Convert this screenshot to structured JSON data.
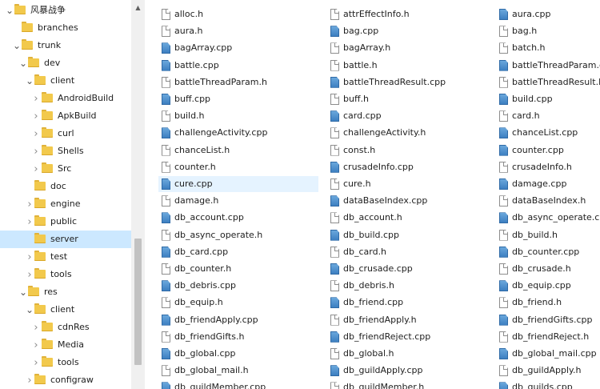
{
  "tree": [
    {
      "label": "风暴战争",
      "level": 0,
      "state": "expanded"
    },
    {
      "label": "branches",
      "level": 1,
      "state": "none"
    },
    {
      "label": "trunk",
      "level": 1,
      "state": "expanded"
    },
    {
      "label": "dev",
      "level": 2,
      "state": "expanded"
    },
    {
      "label": "client",
      "level": 3,
      "state": "expanded"
    },
    {
      "label": "AndroidBuild",
      "level": 4,
      "state": "collapsed"
    },
    {
      "label": "ApkBuild",
      "level": 4,
      "state": "collapsed"
    },
    {
      "label": "curl",
      "level": 4,
      "state": "collapsed"
    },
    {
      "label": "Shells",
      "level": 4,
      "state": "collapsed"
    },
    {
      "label": "Src",
      "level": 4,
      "state": "collapsed"
    },
    {
      "label": "doc",
      "level": 3,
      "state": "none"
    },
    {
      "label": "engine",
      "level": 3,
      "state": "collapsed"
    },
    {
      "label": "public",
      "level": 3,
      "state": "collapsed"
    },
    {
      "label": "server",
      "level": 3,
      "state": "none",
      "selected": true
    },
    {
      "label": "test",
      "level": 3,
      "state": "collapsed"
    },
    {
      "label": "tools",
      "level": 3,
      "state": "collapsed"
    },
    {
      "label": "res",
      "level": 2,
      "state": "expanded"
    },
    {
      "label": "client",
      "level": 3,
      "state": "expanded"
    },
    {
      "label": "cdnRes",
      "level": 4,
      "state": "collapsed"
    },
    {
      "label": "Media",
      "level": 4,
      "state": "collapsed"
    },
    {
      "label": "tools",
      "level": 4,
      "state": "collapsed"
    },
    {
      "label": "configraw",
      "level": 3,
      "state": "collapsed"
    }
  ],
  "files": [
    [
      {
        "name": "alloc.h",
        "type": "h"
      },
      {
        "name": "aura.h",
        "type": "h"
      },
      {
        "name": "bagArray.cpp",
        "type": "cpp"
      },
      {
        "name": "battle.cpp",
        "type": "cpp"
      },
      {
        "name": "battleThreadParam.h",
        "type": "h"
      },
      {
        "name": "buff.cpp",
        "type": "cpp"
      },
      {
        "name": "build.h",
        "type": "h"
      },
      {
        "name": "challengeActivity.cpp",
        "type": "cpp"
      },
      {
        "name": "chanceList.h",
        "type": "h"
      },
      {
        "name": "counter.h",
        "type": "h"
      },
      {
        "name": "cure.cpp",
        "type": "cpp",
        "selected": true
      },
      {
        "name": "damage.h",
        "type": "h"
      },
      {
        "name": "db_account.cpp",
        "type": "cpp"
      },
      {
        "name": "db_async_operate.h",
        "type": "h"
      },
      {
        "name": "db_card.cpp",
        "type": "cpp"
      },
      {
        "name": "db_counter.h",
        "type": "h"
      },
      {
        "name": "db_debris.cpp",
        "type": "cpp"
      },
      {
        "name": "db_equip.h",
        "type": "h"
      },
      {
        "name": "db_friendApply.cpp",
        "type": "cpp"
      },
      {
        "name": "db_friendGifts.h",
        "type": "h"
      },
      {
        "name": "db_global.cpp",
        "type": "cpp"
      },
      {
        "name": "db_global_mail.h",
        "type": "h"
      },
      {
        "name": "db_guildMember.cpp",
        "type": "cpp"
      }
    ],
    [
      {
        "name": "attrEffectInfo.h",
        "type": "h"
      },
      {
        "name": "bag.cpp",
        "type": "cpp"
      },
      {
        "name": "bagArray.h",
        "type": "h"
      },
      {
        "name": "battle.h",
        "type": "h"
      },
      {
        "name": "battleThreadResult.cpp",
        "type": "cpp"
      },
      {
        "name": "buff.h",
        "type": "h"
      },
      {
        "name": "card.cpp",
        "type": "cpp"
      },
      {
        "name": "challengeActivity.h",
        "type": "h"
      },
      {
        "name": "const.h",
        "type": "h"
      },
      {
        "name": "crusadeInfo.cpp",
        "type": "cpp"
      },
      {
        "name": "cure.h",
        "type": "h"
      },
      {
        "name": "dataBaseIndex.cpp",
        "type": "cpp"
      },
      {
        "name": "db_account.h",
        "type": "h"
      },
      {
        "name": "db_build.cpp",
        "type": "cpp"
      },
      {
        "name": "db_card.h",
        "type": "h"
      },
      {
        "name": "db_crusade.cpp",
        "type": "cpp"
      },
      {
        "name": "db_debris.h",
        "type": "h"
      },
      {
        "name": "db_friend.cpp",
        "type": "cpp"
      },
      {
        "name": "db_friendApply.h",
        "type": "h"
      },
      {
        "name": "db_friendReject.cpp",
        "type": "cpp"
      },
      {
        "name": "db_global.h",
        "type": "h"
      },
      {
        "name": "db_guildApply.cpp",
        "type": "cpp"
      },
      {
        "name": "db_guildMember.h",
        "type": "h"
      }
    ],
    [
      {
        "name": "aura.cpp",
        "type": "cpp"
      },
      {
        "name": "bag.h",
        "type": "h"
      },
      {
        "name": "batch.h",
        "type": "h"
      },
      {
        "name": "battleThreadParam.cpp",
        "type": "cpp"
      },
      {
        "name": "battleThreadResult.h",
        "type": "h"
      },
      {
        "name": "build.cpp",
        "type": "cpp"
      },
      {
        "name": "card.h",
        "type": "h"
      },
      {
        "name": "chanceList.cpp",
        "type": "cpp"
      },
      {
        "name": "counter.cpp",
        "type": "cpp"
      },
      {
        "name": "crusadeInfo.h",
        "type": "h"
      },
      {
        "name": "damage.cpp",
        "type": "cpp"
      },
      {
        "name": "dataBaseIndex.h",
        "type": "h"
      },
      {
        "name": "db_async_operate.cpp",
        "type": "cpp"
      },
      {
        "name": "db_build.h",
        "type": "h"
      },
      {
        "name": "db_counter.cpp",
        "type": "cpp"
      },
      {
        "name": "db_crusade.h",
        "type": "h"
      },
      {
        "name": "db_equip.cpp",
        "type": "cpp"
      },
      {
        "name": "db_friend.h",
        "type": "h"
      },
      {
        "name": "db_friendGifts.cpp",
        "type": "cpp"
      },
      {
        "name": "db_friendReject.h",
        "type": "h"
      },
      {
        "name": "db_global_mail.cpp",
        "type": "cpp"
      },
      {
        "name": "db_guildApply.h",
        "type": "h"
      },
      {
        "name": "db_guilds.cpp",
        "type": "cpp"
      }
    ]
  ],
  "icons": {
    "expanded": "chevron-down-icon",
    "collapsed": "chevron-right-icon",
    "folder": "folder-icon",
    "header_file": "header-file-icon",
    "cpp_file": "cpp-file-icon",
    "scroll_up": "scroll-up-arrow-icon"
  },
  "colors": {
    "selection_tree": "#cce8ff",
    "selection_file": "#e5f3ff",
    "folder": "#f2c94c",
    "cpp_icon": "#3d7fc1"
  }
}
